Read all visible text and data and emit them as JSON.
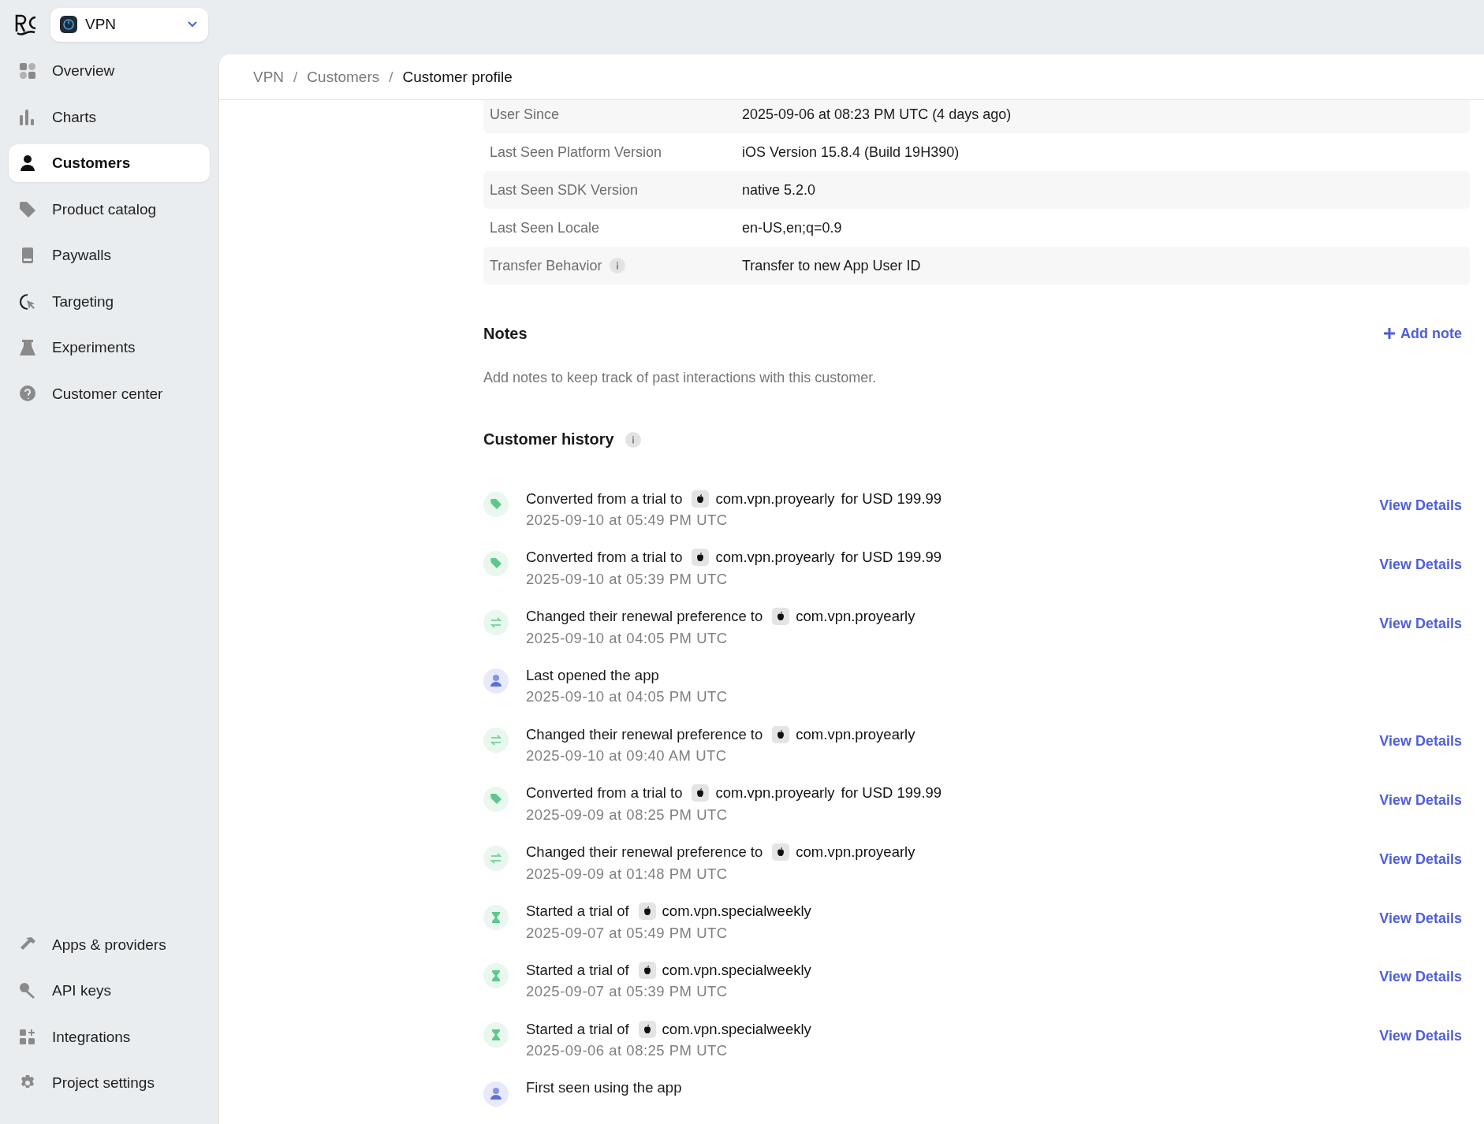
{
  "project_selector": {
    "name": "VPN"
  },
  "sidebar": {
    "items": [
      {
        "label": "Overview",
        "selected": false
      },
      {
        "label": "Charts",
        "selected": false
      },
      {
        "label": "Customers",
        "selected": true
      },
      {
        "label": "Product catalog",
        "selected": false
      },
      {
        "label": "Paywalls",
        "selected": false
      },
      {
        "label": "Targeting",
        "selected": false
      },
      {
        "label": "Experiments",
        "selected": false
      },
      {
        "label": "Customer center",
        "selected": false
      }
    ],
    "bottom_items": [
      {
        "label": "Apps & providers",
        "selected": false
      },
      {
        "label": "API keys",
        "selected": false
      },
      {
        "label": "Integrations",
        "selected": false
      },
      {
        "label": "Project settings",
        "selected": false
      }
    ]
  },
  "breadcrumb": {
    "separator": "/",
    "items": [
      {
        "label": "VPN",
        "current": false
      },
      {
        "label": "Customers",
        "current": false
      },
      {
        "label": "Customer profile",
        "current": true
      }
    ]
  },
  "details": [
    {
      "label": "User Since",
      "value": "2025-09-06 at 08:23 PM UTC (4 days ago)",
      "info": false
    },
    {
      "label": "Last Seen Platform Version",
      "value": "iOS Version 15.8.4 (Build 19H390)",
      "info": false
    },
    {
      "label": "Last Seen SDK Version",
      "value": "native 5.2.0",
      "info": false
    },
    {
      "label": "Last Seen Locale",
      "value": "en-US,en;q=0.9",
      "info": false
    },
    {
      "label": "Transfer Behavior",
      "value": "Transfer to new App User ID",
      "info": true
    }
  ],
  "notes": {
    "title": "Notes",
    "add_button": "Add note",
    "description": "Add notes to keep track of past interactions with this customer."
  },
  "history": {
    "title": "Customer history",
    "events": [
      {
        "kind": "conversion",
        "text": "Converted from a trial to",
        "product": "com.vpn.proyearly",
        "suffix": "for USD 199.99",
        "time": "2025-09-10 at 05:49 PM UTC",
        "link": "View Details"
      },
      {
        "kind": "conversion",
        "text": "Converted from a trial to",
        "product": "com.vpn.proyearly",
        "suffix": "for USD 199.99",
        "time": "2025-09-10 at 05:39 PM UTC",
        "link": "View Details"
      },
      {
        "kind": "renewal",
        "text": "Changed their renewal preference to",
        "product": "com.vpn.proyearly",
        "time": "2025-09-10 at 04:05 PM UTC",
        "link": "View Details"
      },
      {
        "kind": "app_open",
        "text": "Last opened the app",
        "time": "2025-09-10 at 04:05 PM UTC"
      },
      {
        "kind": "renewal",
        "text": "Changed their renewal preference to",
        "product": "com.vpn.proyearly",
        "time": "2025-09-10 at 09:40 AM UTC",
        "link": "View Details"
      },
      {
        "kind": "conversion",
        "text": "Converted from a trial to",
        "product": "com.vpn.proyearly",
        "suffix": "for USD 199.99",
        "time": "2025-09-09 at 08:25 PM UTC",
        "link": "View Details"
      },
      {
        "kind": "renewal",
        "text": "Changed their renewal preference to",
        "product": "com.vpn.proyearly",
        "time": "2025-09-09 at 01:48 PM UTC",
        "link": "View Details"
      },
      {
        "kind": "trial",
        "text": "Started a trial of",
        "product": "com.vpn.specialweekly",
        "time": "2025-09-07 at 05:49 PM UTC",
        "link": "View Details"
      },
      {
        "kind": "trial",
        "text": "Started a trial of",
        "product": "com.vpn.specialweekly",
        "time": "2025-09-07 at 05:39 PM UTC",
        "link": "View Details"
      },
      {
        "kind": "trial",
        "text": "Started a trial of",
        "product": "com.vpn.specialweekly",
        "time": "2025-09-06 at 08:25 PM UTC",
        "link": "View Details"
      },
      {
        "kind": "app_open",
        "text": "First seen using the app"
      }
    ]
  }
}
